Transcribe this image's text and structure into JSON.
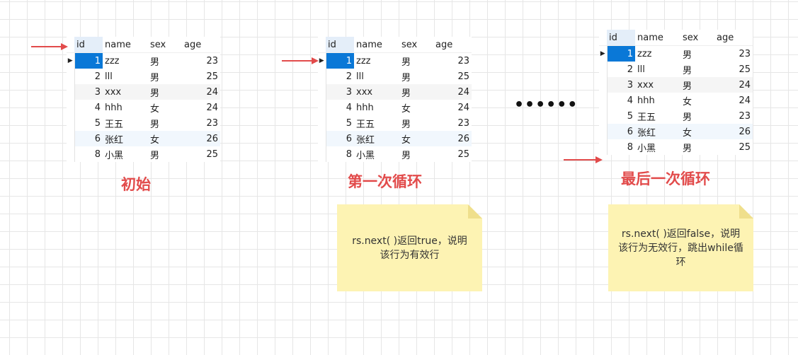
{
  "columns": [
    "id",
    "name",
    "sex",
    "age"
  ],
  "rows": [
    {
      "id": "1",
      "name": "zzz",
      "sex": "男",
      "age": "23"
    },
    {
      "id": "2",
      "name": "lll",
      "sex": "男",
      "age": "25"
    },
    {
      "id": "3",
      "name": "xxx",
      "sex": "男",
      "age": "24"
    },
    {
      "id": "4",
      "name": "hhh",
      "sex": "女",
      "age": "24"
    },
    {
      "id": "5",
      "name": "王五",
      "sex": "男",
      "age": "23"
    },
    {
      "id": "6",
      "name": "张红",
      "sex": "女",
      "age": "26"
    },
    {
      "id": "8",
      "name": "小黑",
      "sex": "男",
      "age": "25"
    }
  ],
  "panels": [
    {
      "caption": "初始"
    },
    {
      "caption": "第一次循环",
      "note": "rs.next( )返回true，说明该行为有效行"
    },
    {
      "caption": "最后一次循环",
      "note": "rs.next( )返回false，说明该行为无效行，跳出while循环"
    }
  ],
  "ellipsis": "••••••",
  "colors": {
    "caption": "#e24b4b",
    "arrow": "#e24b4b",
    "selected": "#0a78d7",
    "note": "#fdf3b3"
  }
}
